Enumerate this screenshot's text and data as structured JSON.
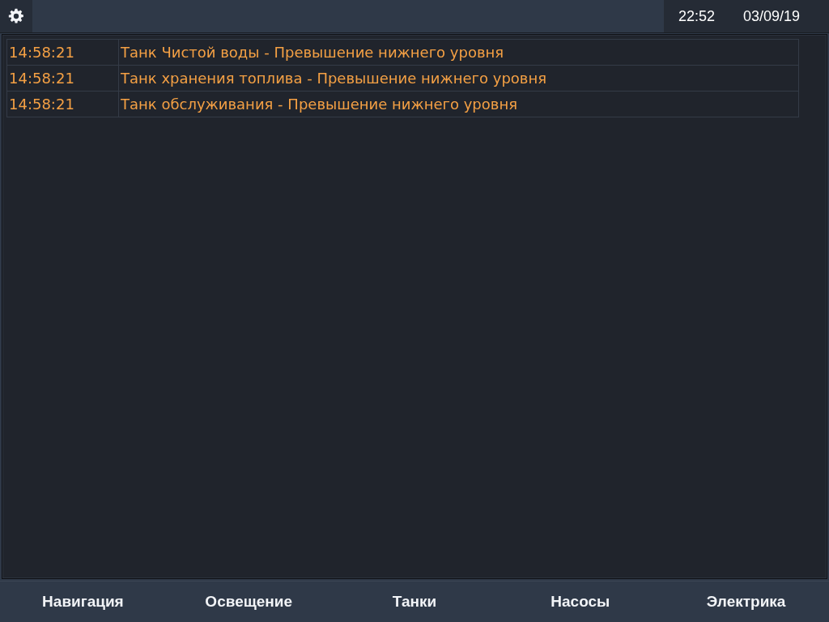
{
  "top_bar": {
    "time": "22:52",
    "date": "03/09/19"
  },
  "alarm_table": {
    "rows": [
      {
        "time": "14:58:21",
        "message": "Танк Чистой воды - Превышение нижнего уровня"
      },
      {
        "time": "14:58:21",
        "message": "Танк хранения топлива - Превышение нижнего уровня"
      },
      {
        "time": "14:58:21",
        "message": "Танк обслуживания - Превышение нижнего уровня"
      }
    ]
  },
  "bottom_nav": [
    {
      "label": "Навигация"
    },
    {
      "label": "Освещение"
    },
    {
      "label": "Танки"
    },
    {
      "label": "Насосы"
    },
    {
      "label": "Электрика"
    }
  ]
}
